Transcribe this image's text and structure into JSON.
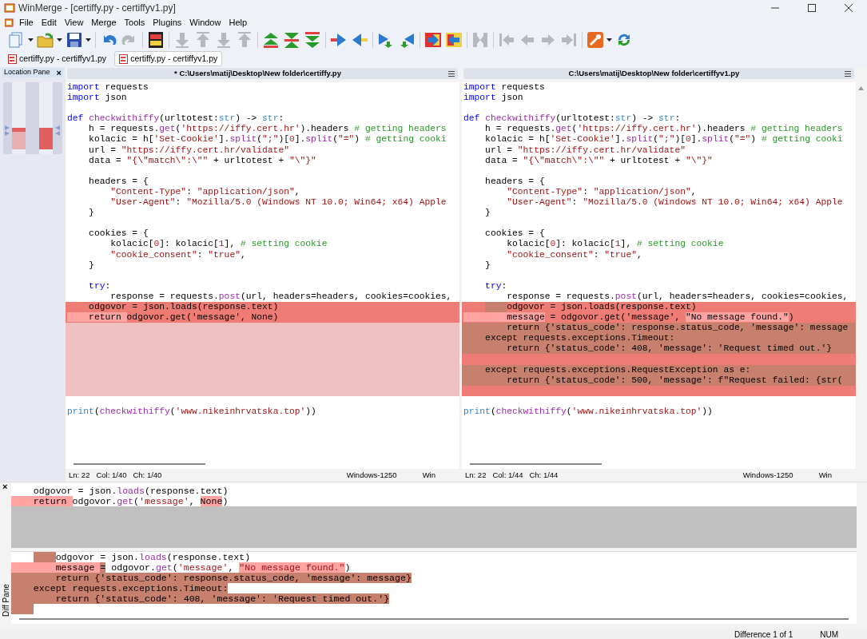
{
  "window": {
    "title": "WinMerge - [certiffy.py - certiffyv1.py]"
  },
  "menu": [
    "File",
    "Edit",
    "View",
    "Merge",
    "Tools",
    "Plugins",
    "Window",
    "Help"
  ],
  "toolbar": [
    {
      "kind": "new",
      "menu": true,
      "disabled": false
    },
    {
      "kind": "open",
      "menu": true,
      "disabled": false
    },
    {
      "kind": "save",
      "menu": true,
      "disabled": false
    },
    {
      "kind": "separator"
    },
    {
      "kind": "undo",
      "menu": false,
      "disabled": false
    },
    {
      "kind": "redo",
      "menu": false,
      "disabled": true
    },
    {
      "kind": "separator"
    },
    {
      "kind": "compare",
      "menu": false,
      "disabled": false
    },
    {
      "kind": "separator"
    },
    {
      "kind": "down",
      "menu": false,
      "disabled": true
    },
    {
      "kind": "up",
      "menu": false,
      "disabled": true
    },
    {
      "kind": "down",
      "menu": false,
      "disabled": true
    },
    {
      "kind": "up",
      "menu": false,
      "disabled": true
    },
    {
      "kind": "separator"
    },
    {
      "kind": "first-diff",
      "menu": false,
      "disabled": false
    },
    {
      "kind": "current-diff",
      "menu": false,
      "disabled": false
    },
    {
      "kind": "last-diff",
      "menu": false,
      "disabled": false
    },
    {
      "kind": "separator"
    },
    {
      "kind": "copy-right",
      "menu": false,
      "disabled": false
    },
    {
      "kind": "copy-left",
      "menu": false,
      "disabled": false
    },
    {
      "kind": "separator"
    },
    {
      "kind": "copy-right-next",
      "menu": false,
      "disabled": false
    },
    {
      "kind": "copy-left-next",
      "menu": false,
      "disabled": false
    },
    {
      "kind": "separator"
    },
    {
      "kind": "all-right",
      "menu": false,
      "disabled": false
    },
    {
      "kind": "all-left",
      "menu": false,
      "disabled": false
    },
    {
      "kind": "separator"
    },
    {
      "kind": "merge",
      "menu": false,
      "disabled": true
    },
    {
      "kind": "separator"
    },
    {
      "kind": "nav-first",
      "menu": false,
      "disabled": true
    },
    {
      "kind": "nav-prev",
      "menu": false,
      "disabled": true
    },
    {
      "kind": "nav-next",
      "menu": false,
      "disabled": true
    },
    {
      "kind": "nav-last",
      "menu": false,
      "disabled": true
    },
    {
      "kind": "separator"
    },
    {
      "kind": "options",
      "menu": true,
      "disabled": false
    },
    {
      "kind": "refresh",
      "menu": false,
      "disabled": false
    }
  ],
  "tabs": [
    {
      "label": "certiffy.py - certiffyv1.py",
      "selected": false
    },
    {
      "label": "certiffy.py - certiffyv1.py",
      "selected": true
    }
  ],
  "location_pane": {
    "title": "Location Pane",
    "close": "×"
  },
  "panes": [
    {
      "path": "* C:\\Users\\matij\\Desktop\\New folder\\certiffy.py",
      "status": [
        "Ln: 22",
        "Col: 1/40",
        "Ch: 1/40"
      ],
      "encoding": "Windows-1250",
      "eol": "Win",
      "lines": [
        {
          "kind": "plain",
          "tokens": [
            {
              "kind": "kw",
              "text": "import"
            },
            {
              "kind": "plain",
              "text": " requests"
            }
          ]
        },
        {
          "kind": "plain",
          "tokens": [
            {
              "kind": "kw",
              "text": "import"
            },
            {
              "kind": "plain",
              "text": " json"
            }
          ]
        },
        {
          "kind": "plain"
        },
        {
          "kind": "plain",
          "tokens": [
            {
              "kind": "kw",
              "text": "def "
            },
            {
              "kind": "fn",
              "text": "checkwithiffy"
            },
            {
              "kind": "plain",
              "text": "(urltotest:"
            },
            {
              "kind": "builtin",
              "text": "str"
            },
            {
              "kind": "plain",
              "text": ") -> "
            },
            {
              "kind": "builtin",
              "text": "str"
            },
            {
              "kind": "plain",
              "text": ":"
            }
          ]
        },
        {
          "kind": "plain",
          "tokens": [
            {
              "kind": "plain",
              "text": "    h = requests."
            },
            {
              "kind": "fn",
              "text": "get"
            },
            {
              "kind": "plain",
              "text": "("
            },
            {
              "kind": "str",
              "text": "'https://iffy.cert.hr'"
            },
            {
              "kind": "plain",
              "text": ").headers "
            },
            {
              "kind": "cmt",
              "text": "# getting headers"
            }
          ]
        },
        {
          "kind": "plain",
          "tokens": [
            {
              "kind": "plain",
              "text": "    kolacic = h["
            },
            {
              "kind": "str",
              "text": "'Set-Cookie'"
            },
            {
              "kind": "plain",
              "text": "]."
            },
            {
              "kind": "fn",
              "text": "split"
            },
            {
              "kind": "plain",
              "text": "("
            },
            {
              "kind": "str",
              "text": "\";\""
            },
            {
              "kind": "plain",
              "text": ")["
            },
            {
              "kind": "num",
              "text": "0"
            },
            {
              "kind": "plain",
              "text": "]."
            },
            {
              "kind": "fn",
              "text": "split"
            },
            {
              "kind": "plain",
              "text": "("
            },
            {
              "kind": "str",
              "text": "\"=\""
            },
            {
              "kind": "plain",
              "text": ") "
            },
            {
              "kind": "cmt",
              "text": "# getting cooki"
            }
          ]
        },
        {
          "kind": "plain",
          "tokens": [
            {
              "kind": "plain",
              "text": "    url = "
            },
            {
              "kind": "str",
              "text": "\"https://iffy.cert.hr/validate\""
            }
          ]
        },
        {
          "kind": "plain",
          "tokens": [
            {
              "kind": "plain",
              "text": "    data = "
            },
            {
              "kind": "str",
              "text": "\"{\\\"match\\\":\\\"\""
            },
            {
              "kind": "plain",
              "text": " + urltotest + "
            },
            {
              "kind": "str",
              "text": "\"\\\"}\""
            }
          ]
        },
        {
          "kind": "plain"
        },
        {
          "kind": "plain",
          "tokens": [
            {
              "kind": "plain",
              "text": "    headers = {"
            }
          ]
        },
        {
          "kind": "plain",
          "tokens": [
            {
              "kind": "str",
              "text": "        \"Content-Type\""
            },
            {
              "kind": "plain",
              "text": ": "
            },
            {
              "kind": "str",
              "text": "\"application/json\""
            },
            {
              "kind": "plain",
              "text": ","
            }
          ]
        },
        {
          "kind": "plain",
          "tokens": [
            {
              "kind": "str",
              "text": "        \"User-Agent\""
            },
            {
              "kind": "plain",
              "text": ": "
            },
            {
              "kind": "str",
              "text": "\"Mozilla/5.0 (Windows NT 10.0; Win64; x64) Apple"
            }
          ]
        },
        {
          "kind": "plain",
          "tokens": [
            {
              "kind": "plain",
              "text": "    }"
            }
          ]
        },
        {
          "kind": "plain"
        },
        {
          "kind": "plain",
          "tokens": [
            {
              "kind": "plain",
              "text": "    cookies = {"
            }
          ]
        },
        {
          "kind": "plain",
          "tokens": [
            {
              "kind": "plain",
              "text": "        kolacic["
            },
            {
              "kind": "num",
              "text": "0"
            },
            {
              "kind": "plain",
              "text": "]: kolacic["
            },
            {
              "kind": "num",
              "text": "1"
            },
            {
              "kind": "plain",
              "text": "], "
            },
            {
              "kind": "cmt",
              "text": "# setting cookie"
            }
          ]
        },
        {
          "kind": "plain",
          "tokens": [
            {
              "kind": "str",
              "text": "        \"cookie_consent\""
            },
            {
              "kind": "plain",
              "text": ": "
            },
            {
              "kind": "str",
              "text": "\"true\""
            },
            {
              "kind": "plain",
              "text": ","
            }
          ]
        },
        {
          "kind": "plain",
          "tokens": [
            {
              "kind": "plain",
              "text": "    }"
            }
          ]
        },
        {
          "kind": "plain"
        },
        {
          "kind": "plain",
          "tokens": [
            {
              "kind": "kw",
              "text": "    try"
            },
            {
              "kind": "plain",
              "text": ":"
            }
          ]
        },
        {
          "kind": "plain",
          "tokens": [
            {
              "kind": "plain",
              "text": "        response = requests."
            },
            {
              "kind": "fn",
              "text": "post"
            },
            {
              "kind": "plain",
              "text": "(url, headers=headers, cookies=cookies,"
            }
          ]
        },
        {
          "kind": "changed",
          "tokens": [
            {
              "kind": "plain",
              "text": "    odgovor = json.loads(response.text)"
            }
          ]
        },
        {
          "kind": "changed",
          "tokens": [
            {
              "kind": "plain",
              "text": "    return ",
              "changed": true
            },
            {
              "kind": "plain",
              "text": "odgovor.get('message', None)"
            }
          ]
        },
        {
          "kind": "gap"
        },
        {
          "kind": "gap"
        },
        {
          "kind": "gap"
        },
        {
          "kind": "gap"
        },
        {
          "kind": "gap"
        },
        {
          "kind": "gap"
        },
        {
          "kind": "gap"
        },
        {
          "kind": "plain"
        },
        {
          "kind": "plain",
          "tokens": [
            {
              "kind": "builtin",
              "text": "print"
            },
            {
              "kind": "plain",
              "text": "("
            },
            {
              "kind": "fn",
              "text": "checkwithiffy"
            },
            {
              "kind": "plain",
              "text": "("
            },
            {
              "kind": "str",
              "text": "'www.nikeinhrvatska.top'"
            },
            {
              "kind": "plain",
              "text": "))"
            }
          ]
        }
      ]
    },
    {
      "path": "C:\\Users\\matij\\Desktop\\New folder\\certiffyv1.py",
      "status": [
        "Ln: 22",
        "Col: 1/44",
        "Ch: 1/44"
      ],
      "encoding": "Windows-1250",
      "eol": "Win",
      "lines": [
        {
          "kind": "plain",
          "tokens": [
            {
              "kind": "kw",
              "text": "import"
            },
            {
              "kind": "plain",
              "text": " requests"
            }
          ]
        },
        {
          "kind": "plain",
          "tokens": [
            {
              "kind": "kw",
              "text": "import"
            },
            {
              "kind": "plain",
              "text": " json"
            }
          ]
        },
        {
          "kind": "plain"
        },
        {
          "kind": "plain",
          "tokens": [
            {
              "kind": "kw",
              "text": "def "
            },
            {
              "kind": "fn",
              "text": "checkwithiffy"
            },
            {
              "kind": "plain",
              "text": "(urltotest:"
            },
            {
              "kind": "builtin",
              "text": "str"
            },
            {
              "kind": "plain",
              "text": ") -> "
            },
            {
              "kind": "builtin",
              "text": "str"
            },
            {
              "kind": "plain",
              "text": ":"
            }
          ]
        },
        {
          "kind": "plain",
          "tokens": [
            {
              "kind": "plain",
              "text": "    h = requests."
            },
            {
              "kind": "fn",
              "text": "get"
            },
            {
              "kind": "plain",
              "text": "("
            },
            {
              "kind": "str",
              "text": "'https://iffy.cert.hr'"
            },
            {
              "kind": "plain",
              "text": ").headers "
            },
            {
              "kind": "cmt",
              "text": "# getting headers"
            }
          ]
        },
        {
          "kind": "plain",
          "tokens": [
            {
              "kind": "plain",
              "text": "    kolacic = h["
            },
            {
              "kind": "str",
              "text": "'Set-Cookie'"
            },
            {
              "kind": "plain",
              "text": "]."
            },
            {
              "kind": "fn",
              "text": "split"
            },
            {
              "kind": "plain",
              "text": "("
            },
            {
              "kind": "str",
              "text": "\";\""
            },
            {
              "kind": "plain",
              "text": ")["
            },
            {
              "kind": "num",
              "text": "0"
            },
            {
              "kind": "plain",
              "text": "]."
            },
            {
              "kind": "fn",
              "text": "split"
            },
            {
              "kind": "plain",
              "text": "("
            },
            {
              "kind": "str",
              "text": "\"=\""
            },
            {
              "kind": "plain",
              "text": ") "
            },
            {
              "kind": "cmt",
              "text": "# getting cooki"
            }
          ]
        },
        {
          "kind": "plain",
          "tokens": [
            {
              "kind": "plain",
              "text": "    url = "
            },
            {
              "kind": "str",
              "text": "\"https://iffy.cert.hr/validate\""
            }
          ]
        },
        {
          "kind": "plain",
          "tokens": [
            {
              "kind": "plain",
              "text": "    data = "
            },
            {
              "kind": "str",
              "text": "\"{\\\"match\\\":\\\"\""
            },
            {
              "kind": "plain",
              "text": " + urltotest + "
            },
            {
              "kind": "str",
              "text": "\"\\\"}\""
            }
          ]
        },
        {
          "kind": "plain"
        },
        {
          "kind": "plain",
          "tokens": [
            {
              "kind": "plain",
              "text": "    headers = {"
            }
          ]
        },
        {
          "kind": "plain",
          "tokens": [
            {
              "kind": "str",
              "text": "        \"Content-Type\""
            },
            {
              "kind": "plain",
              "text": ": "
            },
            {
              "kind": "str",
              "text": "\"application/json\""
            },
            {
              "kind": "plain",
              "text": ","
            }
          ]
        },
        {
          "kind": "plain",
          "tokens": [
            {
              "kind": "str",
              "text": "        \"User-Agent\""
            },
            {
              "kind": "plain",
              "text": ": "
            },
            {
              "kind": "str",
              "text": "\"Mozilla/5.0 (Windows NT 10.0; Win64; x64) Apple"
            }
          ]
        },
        {
          "kind": "plain",
          "tokens": [
            {
              "kind": "plain",
              "text": "    }"
            }
          ]
        },
        {
          "kind": "plain"
        },
        {
          "kind": "plain",
          "tokens": [
            {
              "kind": "plain",
              "text": "    cookies = {"
            }
          ]
        },
        {
          "kind": "plain",
          "tokens": [
            {
              "kind": "plain",
              "text": "        kolacic["
            },
            {
              "kind": "num",
              "text": "0"
            },
            {
              "kind": "plain",
              "text": "]: kolacic["
            },
            {
              "kind": "num",
              "text": "1"
            },
            {
              "kind": "plain",
              "text": "], "
            },
            {
              "kind": "cmt",
              "text": "# setting cookie"
            }
          ]
        },
        {
          "kind": "plain",
          "tokens": [
            {
              "kind": "str",
              "text": "        \"cookie_consent\""
            },
            {
              "kind": "plain",
              "text": ": "
            },
            {
              "kind": "str",
              "text": "\"true\""
            },
            {
              "kind": "plain",
              "text": ","
            }
          ]
        },
        {
          "kind": "plain",
          "tokens": [
            {
              "kind": "plain",
              "text": "    }"
            }
          ]
        },
        {
          "kind": "plain"
        },
        {
          "kind": "plain",
          "tokens": [
            {
              "kind": "kw",
              "text": "    try"
            },
            {
              "kind": "plain",
              "text": ":"
            }
          ]
        },
        {
          "kind": "plain",
          "tokens": [
            {
              "kind": "plain",
              "text": "        response = requests."
            },
            {
              "kind": "fn",
              "text": "post"
            },
            {
              "kind": "plain",
              "text": "(url, headers=headers, cookies=cookies,"
            }
          ]
        },
        {
          "kind": "changed",
          "tokens": [
            {
              "kind": "pad"
            },
            {
              "kind": "pad",
              "moved": true
            },
            {
              "kind": "plain",
              "text": "odgovor = json.loads(response.text)"
            }
          ]
        },
        {
          "kind": "changed",
          "tokens": [
            {
              "kind": "plain",
              "text": "        message",
              "changed": true
            },
            {
              "kind": "plain",
              "text": " = odgovor.get('message', "
            },
            {
              "kind": "plain",
              "text": "\"No message found.\"",
              "changed": true
            },
            {
              "kind": "plain",
              "text": ")"
            }
          ]
        },
        {
          "kind": "moved",
          "tokens": [
            {
              "kind": "plain",
              "text": "        return {'status_code': response.status_code, 'message': message"
            }
          ]
        },
        {
          "kind": "moved",
          "tokens": [
            {
              "kind": "plain",
              "text": "    except requests.exceptions.Timeout:"
            }
          ]
        },
        {
          "kind": "moved",
          "tokens": [
            {
              "kind": "plain",
              "text": "        return {'status_code': 408, 'message': 'Request timed out.'}"
            }
          ]
        },
        {
          "kind": "changed"
        },
        {
          "kind": "moved",
          "tokens": [
            {
              "kind": "plain",
              "text": "    except requests.exceptions.RequestException as e:"
            }
          ]
        },
        {
          "kind": "moved",
          "tokens": [
            {
              "kind": "plain",
              "text": "        return {'status_code': 500, 'message': f\"Request failed: {str("
            }
          ]
        },
        {
          "kind": "changed"
        },
        {
          "kind": "plain"
        },
        {
          "kind": "plain",
          "tokens": [
            {
              "kind": "builtin",
              "text": "print"
            },
            {
              "kind": "plain",
              "text": "("
            },
            {
              "kind": "fn",
              "text": "checkwithiffy"
            },
            {
              "kind": "plain",
              "text": "("
            },
            {
              "kind": "str",
              "text": "'www.nikeinhrvatska.top'"
            },
            {
              "kind": "plain",
              "text": "))"
            }
          ]
        }
      ]
    }
  ],
  "diff_pane": {
    "title": "Diff Pane",
    "close": "×",
    "left_lines": [
      {
        "kind": "plain",
        "tokens": [
          {
            "kind": "plain",
            "text": "    odgovor = json."
          },
          {
            "kind": "fn",
            "text": "loads"
          },
          {
            "kind": "plain",
            "text": "(response.text)"
          }
        ]
      },
      {
        "kind": "plain",
        "tokens": [
          {
            "kind": "plain",
            "text": "    return ",
            "changed": true
          },
          {
            "kind": "plain",
            "text": "odgovor."
          },
          {
            "kind": "fn",
            "text": "get"
          },
          {
            "kind": "plain",
            "text": "("
          },
          {
            "kind": "str",
            "text": "'message'"
          },
          {
            "kind": "plain",
            "text": ", "
          },
          {
            "kind": "plain",
            "text": "None",
            "changed": true
          },
          {
            "kind": "plain",
            "text": ")"
          }
        ]
      },
      {
        "kind": "gap"
      },
      {
        "kind": "gap"
      },
      {
        "kind": "gap"
      },
      {
        "kind": "gap"
      }
    ],
    "right_lines": [
      {
        "kind": "plain",
        "tokens": [
          {
            "kind": "pad"
          },
          {
            "kind": "pad",
            "moved": true
          },
          {
            "kind": "plain",
            "text": "odgovor = json."
          },
          {
            "kind": "fn",
            "text": "loads"
          },
          {
            "kind": "plain",
            "text": "(response.text)"
          }
        ]
      },
      {
        "kind": "plain",
        "tokens": [
          {
            "kind": "plain",
            "text": "        message ",
            "changed": true
          },
          {
            "kind": "plain",
            "text": "=",
            "moved": true
          },
          {
            "kind": "plain",
            "text": " odgovor."
          },
          {
            "kind": "fn",
            "text": "get"
          },
          {
            "kind": "plain",
            "text": "("
          },
          {
            "kind": "str",
            "text": "'message'"
          },
          {
            "kind": "plain",
            "text": ", "
          },
          {
            "kind": "str",
            "text": "\"No message found.\"",
            "changed": true
          },
          {
            "kind": "plain",
            "text": ")"
          }
        ]
      },
      {
        "kind": "moved",
        "tokens": [
          {
            "kind": "plain",
            "text": "        return {'status_code': response.status_code, 'message': message}"
          }
        ]
      },
      {
        "kind": "moved",
        "tokens": [
          {
            "kind": "plain",
            "text": "    except requests.exceptions.Timeout:"
          }
        ]
      },
      {
        "kind": "moved",
        "tokens": [
          {
            "kind": "plain",
            "text": "        return {'status_code': 408, 'message': 'Request timed out.'}"
          }
        ]
      },
      {
        "kind": "plain",
        "tokens": [
          {
            "kind": "pad",
            "moved": true
          }
        ]
      }
    ]
  },
  "status_bar": [
    "Difference 1 of 1",
    "NUM"
  ]
}
